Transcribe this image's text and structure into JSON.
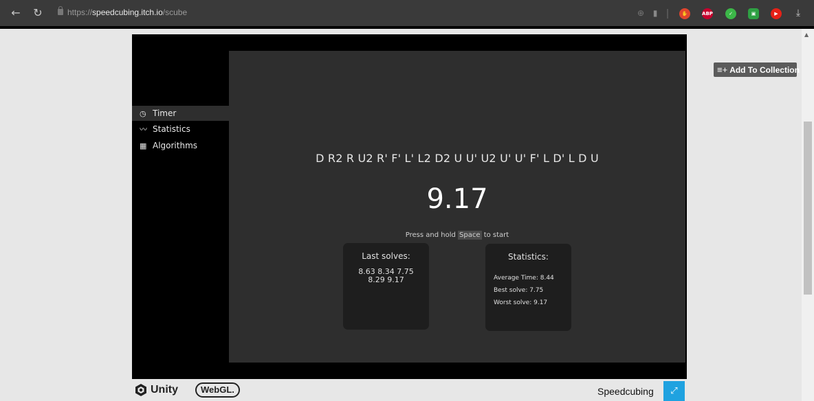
{
  "browser": {
    "url_scheme": "https://",
    "url_host": "speedcubing.itch.io",
    "url_path": "/scube",
    "back_icon": "back-arrow-icon",
    "reload_icon": "reload-icon",
    "extensions": [
      {
        "name": "ublock",
        "color": "#e0452e",
        "label": "✋"
      },
      {
        "name": "abp",
        "color": "#c8002d",
        "label": "ABP"
      },
      {
        "name": "shield",
        "color": "#3cb648",
        "label": "✓"
      },
      {
        "name": "game",
        "color": "#2ea043",
        "label": "▣"
      },
      {
        "name": "youtube",
        "color": "#e62117",
        "label": "▶"
      }
    ]
  },
  "itch": {
    "add_to_collection": "Add To Collection"
  },
  "sidebar": {
    "items": [
      {
        "label": "Timer",
        "icon": "clock-icon",
        "active": true
      },
      {
        "label": "Statistics",
        "icon": "chart-icon",
        "active": false
      },
      {
        "label": "Algorithms",
        "icon": "grid-icon",
        "active": false
      }
    ]
  },
  "main": {
    "scramble": "D R2 R U2 R' F' L' L2 D2 U U' U2 U' U' F' L D' L D U",
    "time": "9.17",
    "hint_before": "Press and hold ",
    "hint_key": "Space",
    "hint_after": " to start"
  },
  "last_solves": {
    "title": "Last solves:",
    "line1": "8.63  8.34  7.75",
    "line2": "8.29  9.17"
  },
  "statistics": {
    "title": "Statistics:",
    "average": "Average Time: 8.44",
    "best": "Best solve: 7.75",
    "worst": "Worst solve: 9.17"
  },
  "footer": {
    "unity": "Unity",
    "webgl": "WebGL.",
    "game_title": "Speedcubing"
  }
}
